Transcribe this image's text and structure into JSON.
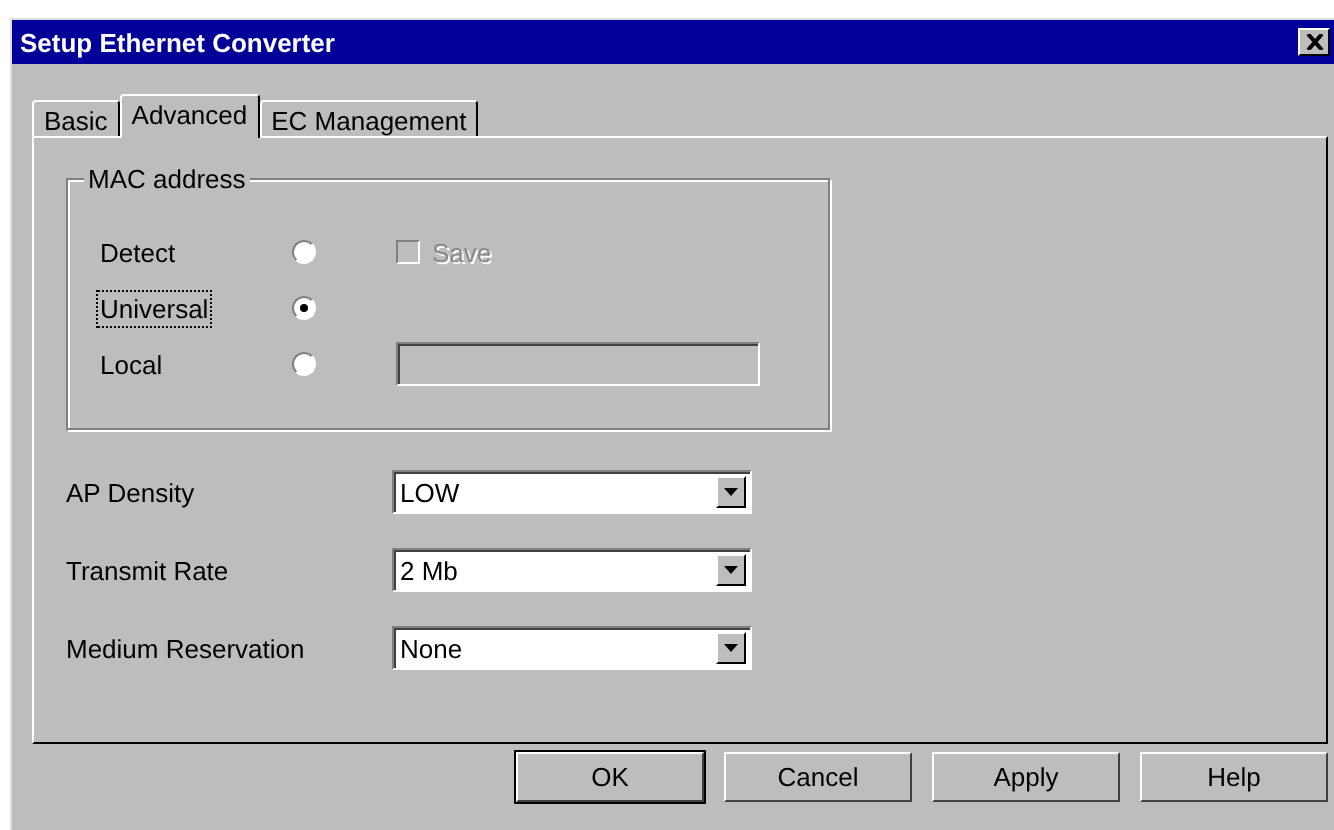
{
  "window": {
    "title": "Setup Ethernet Converter"
  },
  "tabs": [
    {
      "label": "Basic",
      "selected": false
    },
    {
      "label": "Advanced",
      "selected": true
    },
    {
      "label": "EC Management",
      "selected": false
    }
  ],
  "mac_address": {
    "label": "MAC address",
    "options": [
      {
        "label": "Detect",
        "selected": false,
        "focused": false
      },
      {
        "label": "Universal",
        "selected": true,
        "focused": true
      },
      {
        "label": "Local",
        "selected": false,
        "focused": false
      }
    ],
    "save": {
      "label": "Save",
      "checked": false,
      "disabled": true
    },
    "local_field": {
      "disabled": true
    }
  },
  "settings": [
    {
      "label": "AP Density",
      "value": "LOW"
    },
    {
      "label": "Transmit Rate",
      "value": "2 Mb"
    },
    {
      "label": "Medium Reservation",
      "value": "None"
    }
  ],
  "buttons": [
    {
      "label": "OK",
      "default": true
    },
    {
      "label": "Cancel",
      "default": false
    },
    {
      "label": "Apply",
      "default": false
    },
    {
      "label": "Help",
      "default": false
    }
  ]
}
